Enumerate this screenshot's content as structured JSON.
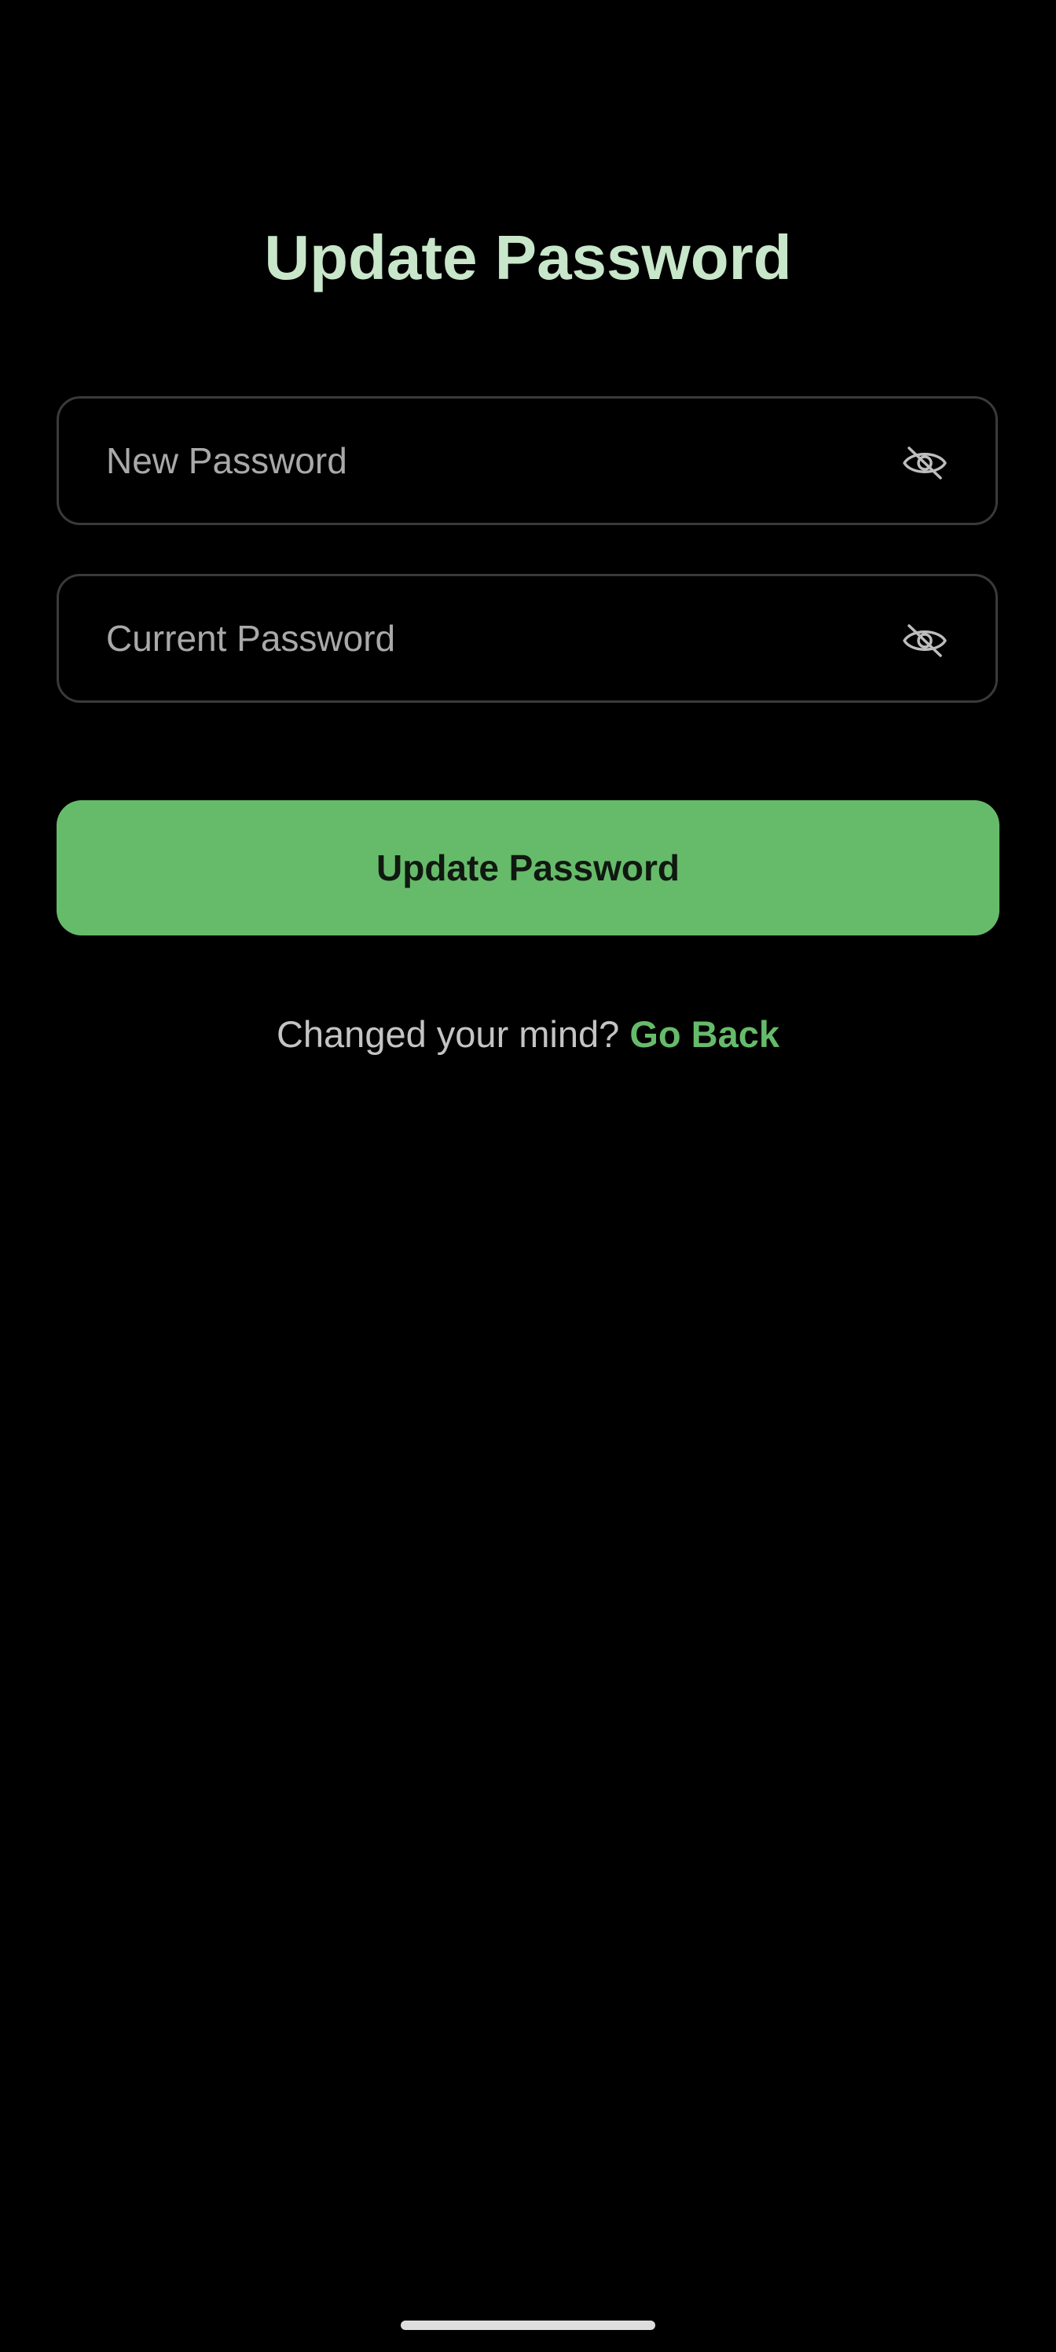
{
  "page": {
    "title": "Update Password"
  },
  "fields": {
    "new_password": {
      "placeholder": "New Password",
      "value": "",
      "toggle_icon": "eye-off-icon"
    },
    "current_password": {
      "placeholder": "Current Password",
      "value": "",
      "toggle_icon": "eye-off-icon"
    }
  },
  "actions": {
    "submit_label": "Update Password"
  },
  "footer": {
    "prompt": "Changed your mind?",
    "link_label": "Go Back"
  },
  "theme": {
    "background": "#000000",
    "title_color": "#c8e6c9",
    "accent": "#66bb6a",
    "field_border": "#3a3a3a",
    "placeholder_color": "#a9a9a9"
  }
}
